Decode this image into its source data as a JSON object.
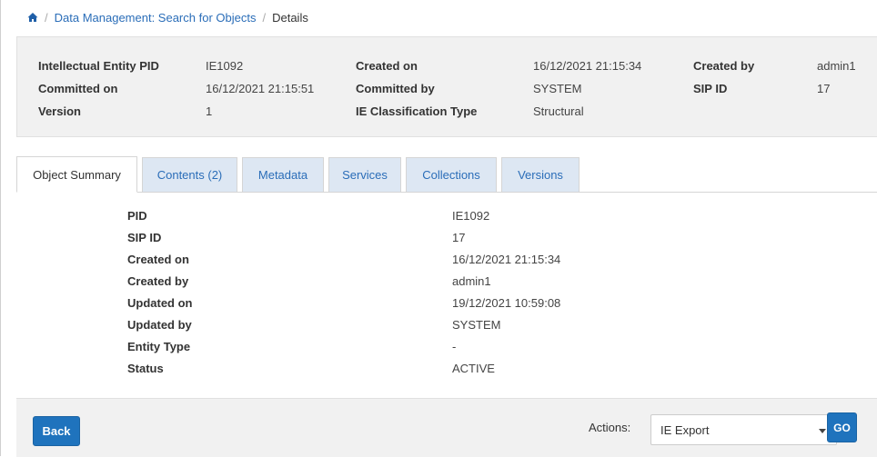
{
  "breadcrumb": {
    "home_icon": "home-icon",
    "separator": "/",
    "link": "Data Management: Search for Objects",
    "current": "Details"
  },
  "header": {
    "ie_pid_label": "Intellectual Entity PID",
    "ie_pid_value": "IE1092",
    "committed_on_label": "Committed on",
    "committed_on_value": "16/12/2021 21:15:51",
    "version_label": "Version",
    "version_value": "1",
    "created_on_label": "Created on",
    "created_on_value": "16/12/2021 21:15:34",
    "committed_by_label": "Committed by",
    "committed_by_value": "SYSTEM",
    "ie_class_label": "IE Classification Type",
    "ie_class_value": "Structural",
    "created_by_label": "Created by",
    "created_by_value": "admin1",
    "sip_id_label": "SIP ID",
    "sip_id_value": "17"
  },
  "tabs": [
    {
      "label": "Object Summary",
      "active": true
    },
    {
      "label": "Contents (2)",
      "active": false
    },
    {
      "label": "Metadata",
      "active": false
    },
    {
      "label": "Services",
      "active": false
    },
    {
      "label": "Collections",
      "active": false
    },
    {
      "label": "Versions",
      "active": false
    }
  ],
  "summary": [
    {
      "label": "PID",
      "value": "IE1092"
    },
    {
      "label": "SIP ID",
      "value": "17"
    },
    {
      "label": "Created on",
      "value": "16/12/2021 21:15:34"
    },
    {
      "label": "Created by",
      "value": "admin1"
    },
    {
      "label": "Updated on",
      "value": "19/12/2021 10:59:08"
    },
    {
      "label": "Updated by",
      "value": "SYSTEM"
    },
    {
      "label": "Entity Type",
      "value": "-"
    },
    {
      "label": "Status",
      "value": "ACTIVE"
    }
  ],
  "footer": {
    "back_label": "Back",
    "actions_label": "Actions:",
    "actions_selected": "IE Export",
    "go_label": "GO"
  },
  "colors": {
    "accent": "#1f73bd",
    "link": "#2a6db8",
    "tab_inactive_bg": "#dde7f3",
    "panel_bg": "#f1f1f1"
  }
}
